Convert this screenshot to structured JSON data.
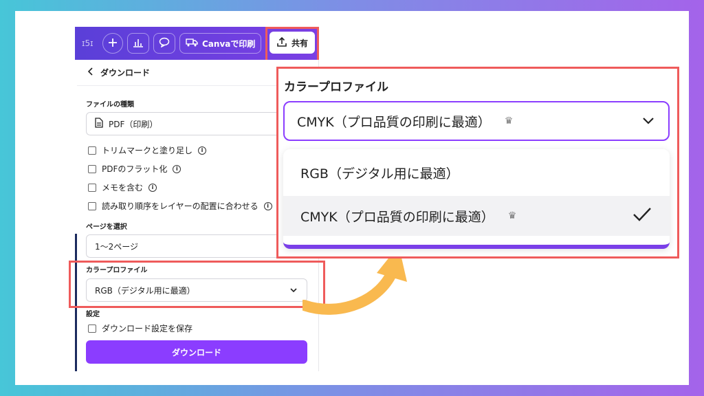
{
  "toolbar": {
    "ghost_text": "ɪ5ɪ",
    "print_label": "Canvaで印刷",
    "share_label": "共有"
  },
  "panel": {
    "header": "ダウンロード",
    "file_type_label": "ファイルの種類",
    "file_type_value": "PDF（印刷）",
    "options": [
      "トリムマークと塗り足し",
      "PDFのフラット化",
      "メモを含む",
      "読み取り順序をレイヤーの配置に合わせる"
    ],
    "pages_label": "ページを選択",
    "pages_value": "1〜2ページ",
    "color_profile_label": "カラープロファイル",
    "color_profile_value": "RGB（デジタル用に最適）",
    "settings_label": "設定",
    "save_settings": "ダウンロード設定を保存",
    "download_button": "ダウンロード"
  },
  "zoom": {
    "title": "カラープロファイル",
    "selected_value": "CMYK（プロ品質の印刷に最適）",
    "menu": [
      "RGB（デジタル用に最適）",
      "CMYK（プロ品質の印刷に最適）"
    ],
    "selected_index": 1
  },
  "colors": {
    "accent": "#8b3dff",
    "highlight": "#ef5b5b",
    "arrow": "#f9b94f"
  },
  "icons": [
    "plus-icon",
    "chart-icon",
    "comment-icon",
    "truck-icon",
    "upload-icon",
    "chevron-left-icon",
    "file-icon",
    "info-icon",
    "chevron-down-icon",
    "crown-icon",
    "check-icon",
    "curved-arrow-icon"
  ]
}
